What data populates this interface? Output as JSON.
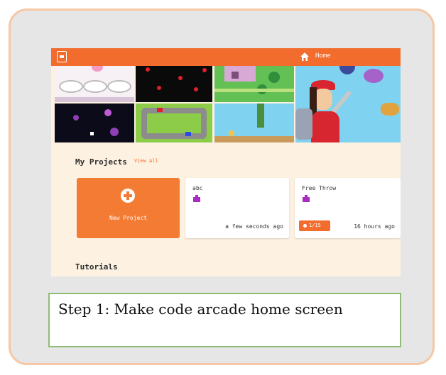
{
  "header": {
    "logo_icon": "makecode-arcade-logo",
    "home_icon": "home-icon",
    "home_label": "Home"
  },
  "banner": {
    "images": [
      "plates-game",
      "cherries-space-game",
      "castle-game",
      "space-shooter-game",
      "race-track-game",
      "platformer-game",
      "hero-character-art"
    ]
  },
  "projects": {
    "title": "My Projects",
    "view_all": "View All",
    "new_project": "New Project",
    "cards": [
      {
        "name": "abc",
        "time": "a few seconds ago",
        "icon": "puzzle-icon"
      },
      {
        "name": "Free Throw",
        "time": "16 hours ago",
        "icon": "puzzle-icon",
        "badge": "1/15"
      }
    ]
  },
  "tutorials": {
    "title": "Tutorials"
  },
  "caption": "Step 1: Make code arcade home screen",
  "colors": {
    "accent": "#f26c2d",
    "page_bg": "#fdf1e1",
    "frame_bg": "#e6e6e6",
    "frame_border": "#f6c7a5",
    "caption_border": "#90bb76"
  }
}
